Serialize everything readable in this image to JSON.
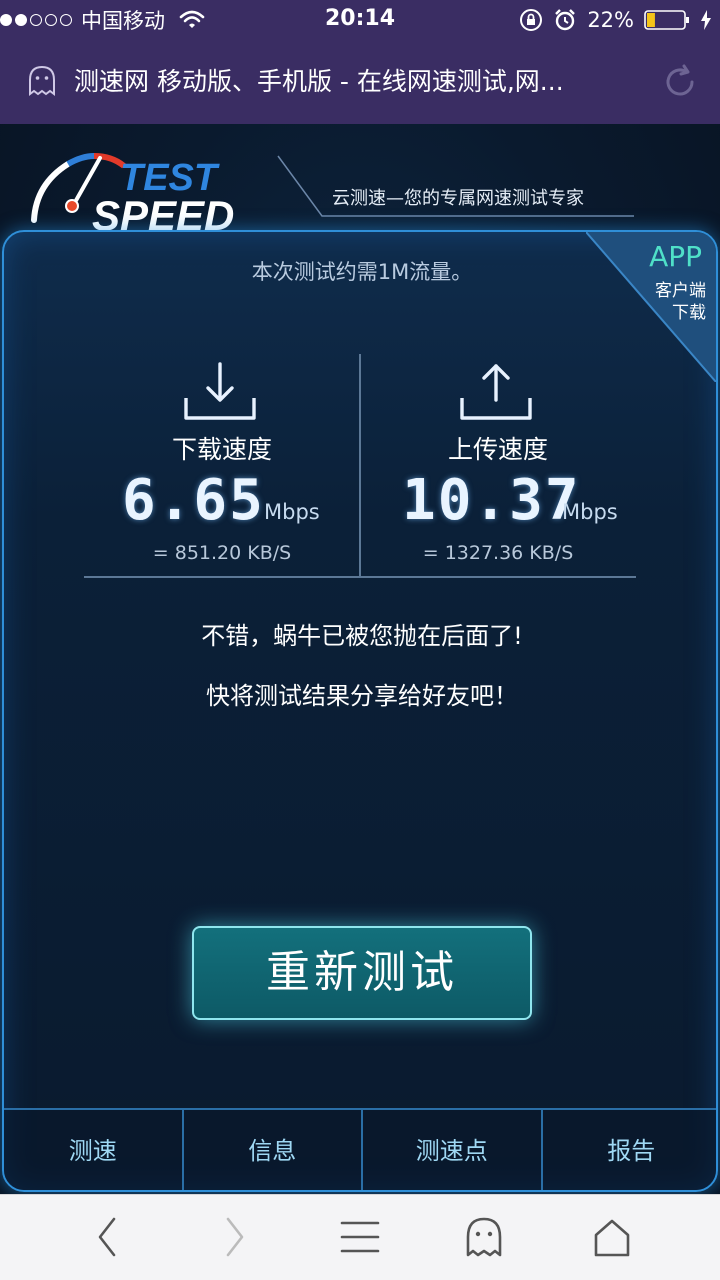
{
  "status_bar": {
    "signal_dots_filled": 2,
    "signal_dots_total": 5,
    "carrier": "中国移动",
    "time": "20:14",
    "battery_percent": "22%",
    "battery_level": 0.22,
    "icons": [
      "wifi-icon",
      "rotation-lock-icon",
      "alarm-icon",
      "battery-icon",
      "charging-bolt-icon"
    ]
  },
  "address_bar": {
    "title": "测速网 移动版、手机版 - 在线网速测试,网...",
    "site_icon": "ghost-shield-icon",
    "reload_icon": "reload-icon"
  },
  "header": {
    "logo_top": "TEST",
    "logo_bottom": "SPEED",
    "tagline": "云测速—您的专属网速测试专家"
  },
  "panel": {
    "notice": "本次测试约需1M流量。",
    "app_badge": {
      "label": "APP",
      "line1": "客户端",
      "line2": "下载"
    },
    "download": {
      "label": "下载速度",
      "value": "6.65",
      "unit": "Mbps",
      "kb": "= 851.20 KB/S",
      "icon": "download-icon"
    },
    "upload": {
      "label": "上传速度",
      "value": "10.37",
      "unit": "Mbps",
      "kb": "= 1327.36 KB/S",
      "icon": "upload-icon"
    },
    "message1": "不错，蜗牛已被您抛在后面了!",
    "message2": "快将测试结果分享给好友吧！",
    "retest_button": "重新测试",
    "nav": [
      "测速",
      "信息",
      "测速点",
      "报告"
    ]
  },
  "colors": {
    "status_bg": "#3a2d63",
    "panel_border": "#2f8fd8",
    "accent_teal": "#4fe0c8",
    "button_bg": "#13707c",
    "nav_text": "#9fd8f4"
  }
}
